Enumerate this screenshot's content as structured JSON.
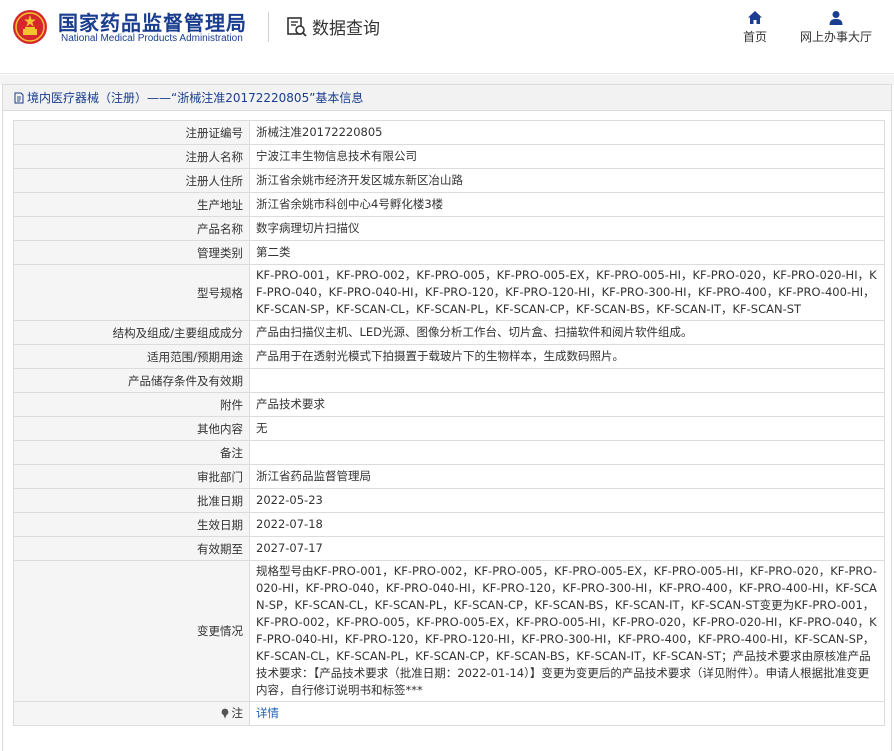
{
  "header": {
    "org_cn": "国家药品监督管理局",
    "org_en": "National Medical Products Administration",
    "section_title": "数据查询",
    "nav": {
      "home": "首页",
      "office": "网上办事大厅"
    },
    "colors": {
      "brand": "#1a3d8f",
      "emblem_red": "#d6262e",
      "emblem_gold": "#f4c430"
    }
  },
  "breadcrumb": {
    "text": "境内医疗器械（注册）——“浙械注准20172220805”基本信息"
  },
  "rows": [
    {
      "label": "注册证编号",
      "value": "浙械注准20172220805"
    },
    {
      "label": "注册人名称",
      "value": "宁波江丰生物信息技术有限公司"
    },
    {
      "label": "注册人住所",
      "value": "浙江省余姚市经济开发区城东新区冶山路"
    },
    {
      "label": "生产地址",
      "value": "浙江省余姚市科创中心4号孵化楼3楼"
    },
    {
      "label": "产品名称",
      "value": "数字病理切片扫描仪"
    },
    {
      "label": "管理类别",
      "value": "第二类"
    },
    {
      "label": "型号规格",
      "value": "KF-PRO-001，KF-PRO-002，KF-PRO-005，KF-PRO-005-EX，KF-PRO-005-HI，KF-PRO-020，KF-PRO-020-HI，KF-PRO-040，KF-PRO-040-HI，KF-PRO-120，KF-PRO-120-HI，KF-PRO-300-HI，KF-PRO-400，KF-PRO-400-HI，KF-SCAN-SP，KF-SCAN-CL，KF-SCAN-PL，KF-SCAN-CP，KF-SCAN-BS，KF-SCAN-IT，KF-SCAN-ST"
    },
    {
      "label": "结构及组成/主要组成成分",
      "value": "产品由扫描仪主机、LED光源、图像分析工作台、切片盒、扫描软件和阅片软件组成。"
    },
    {
      "label": "适用范围/预期用途",
      "value": "产品用于在透射光模式下拍摄置于载玻片下的生物样本，生成数码照片。"
    },
    {
      "label": "产品储存条件及有效期",
      "value": ""
    },
    {
      "label": "附件",
      "value": "产品技术要求"
    },
    {
      "label": "其他内容",
      "value": "无"
    },
    {
      "label": "备注",
      "value": ""
    },
    {
      "label": "审批部门",
      "value": "浙江省药品监督管理局"
    },
    {
      "label": "批准日期",
      "value": "2022-05-23"
    },
    {
      "label": "生效日期",
      "value": "2022-07-18"
    },
    {
      "label": "有效期至",
      "value": "2027-07-17"
    },
    {
      "label": "变更情况",
      "value": "规格型号由KF-PRO-001，KF-PRO-002，KF-PRO-005，KF-PRO-005-EX，KF-PRO-005-HI，KF-PRO-020，KF-PRO-020-HI，KF-PRO-040，KF-PRO-040-HI，KF-PRO-120，KF-PRO-300-HI，KF-PRO-400，KF-PRO-400-HI，KF-SCAN-SP，KF-SCAN-CL，KF-SCAN-PL，KF-SCAN-CP，KF-SCAN-BS，KF-SCAN-IT，KF-SCAN-ST变更为KF-PRO-001，KF-PRO-002，KF-PRO-005，KF-PRO-005-EX，KF-PRO-005-HI，KF-PRO-020，KF-PRO-020-HI，KF-PRO-040，KF-PRO-040-HI，KF-PRO-120，KF-PRO-120-HI，KF-PRO-300-HI，KF-PRO-400，KF-PRO-400-HI，KF-SCAN-SP，KF-SCAN-CL，KF-SCAN-PL，KF-SCAN-CP，KF-SCAN-BS，KF-SCAN-IT，KF-SCAN-ST；产品技术要求由原核准产品技术要求：【产品技术要求（批准日期：2022-01-14）】变更为变更后的产品技术要求（详见附件）。申请人根据批准变更内容，自行修订说明书和标签***"
    }
  ],
  "note_row": {
    "label": "注",
    "link": "详情"
  }
}
